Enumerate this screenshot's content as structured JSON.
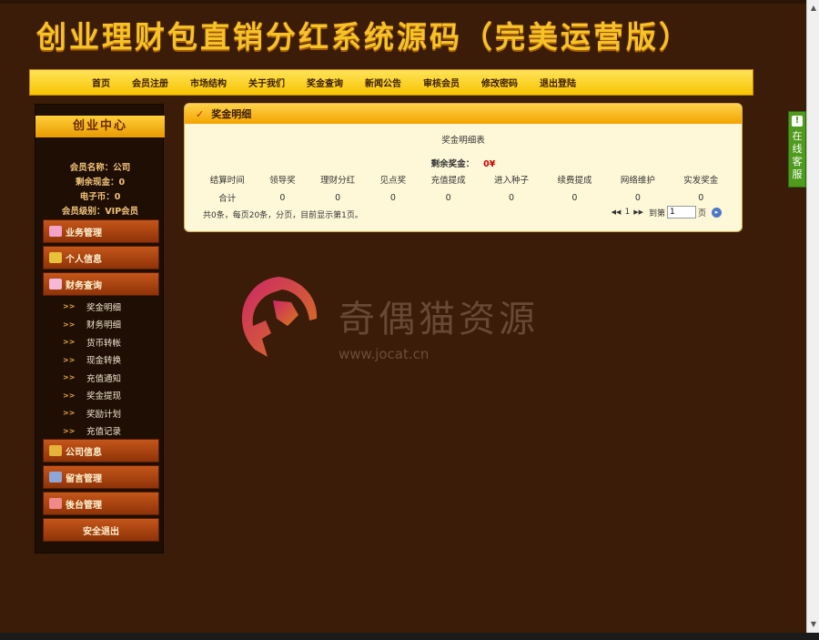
{
  "site_title": "创业理财包直销分红系统源码（完美运营版）",
  "nav": [
    "首页",
    "会员注册",
    "市场结构",
    "关于我们",
    "奖金查询",
    "新闻公告",
    "审核会员",
    "修改密码",
    "退出登陆"
  ],
  "sidebar": {
    "heading": "创业中心",
    "info": {
      "member_name": "会员名称：公司",
      "cash_balance": "剩余现金：0",
      "e_coin": "电子币：0",
      "level": "会员级别：VIP会员"
    },
    "sections": {
      "business": "业务管理",
      "personal": "个人信息",
      "finance": "财务查询",
      "company": "公司信息",
      "messages": "留言管理",
      "admin": "後台管理",
      "logout": "安全退出"
    },
    "finance_items": [
      "奖金明细",
      "财务明细",
      "货币转帐",
      "现金转换",
      "充值通知",
      "奖金提现",
      "奖励计划",
      "充值记录"
    ],
    "arrow": ">>"
  },
  "panel": {
    "title": "奖金明细",
    "subtitle": "奖金明细表",
    "balance_label": "剩余奖金：",
    "balance_value": "0¥",
    "columns": [
      "结算时间",
      "领导奖",
      "理财分红",
      "见点奖",
      "充值提成",
      "进入种子",
      "续费提成",
      "网络维护",
      "实发奖金"
    ],
    "total_row": [
      "合计",
      "0",
      "0",
      "0",
      "0",
      "0",
      "0",
      "0",
      "0"
    ],
    "pager_text": "共0条，每页20条，分页，目前显示第1页。",
    "pager": {
      "prev": "◀◀",
      "current": "1",
      "next": "▶▶",
      "goto_label": "到第",
      "goto_value": "1",
      "page_suffix": "页"
    }
  },
  "watermark": {
    "text": "奇偶猫资源",
    "url": "www.jocat.cn"
  },
  "service_tab": [
    "在",
    "线",
    "客",
    "服"
  ]
}
